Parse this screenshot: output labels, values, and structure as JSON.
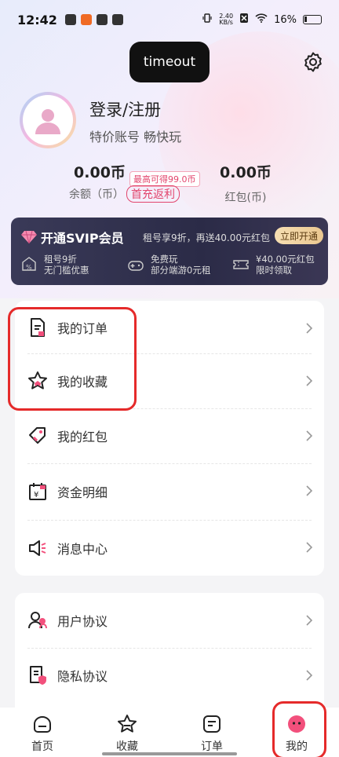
{
  "status_bar": {
    "time": "12:42",
    "net_speed_value": "2.40",
    "net_speed_unit": "KB/s",
    "battery": "16%"
  },
  "header": {
    "timeout_label": "timeout"
  },
  "profile": {
    "title": "登录/注册",
    "subtitle": "特价账号 畅快玩"
  },
  "balance": {
    "amount": "0.00币",
    "amount_label": "余额（币）",
    "recharge_tag": "首充返利",
    "max_tag": "最高可得99.0币",
    "red_packet": "0.00币",
    "red_packet_label": "红包(币)"
  },
  "vip": {
    "title": "开通SVIP会员",
    "desc": "租号享9折，再送40.00元红包",
    "button": "立即开通",
    "perks": [
      {
        "line1": "租号9折",
        "line2": "无门槛优惠"
      },
      {
        "line1": "免费玩",
        "line2": "部分端游0元租"
      },
      {
        "line1": "¥40.00元红包",
        "line2": "限时领取"
      }
    ]
  },
  "menu_group_1": [
    {
      "label": "我的订单",
      "icon": "document-icon"
    },
    {
      "label": "我的收藏",
      "icon": "star-icon"
    },
    {
      "label": "我的红包",
      "icon": "tag-icon"
    },
    {
      "label": "资金明细",
      "icon": "calendar-yen-icon"
    },
    {
      "label": "消息中心",
      "icon": "speaker-icon"
    }
  ],
  "menu_group_2": [
    {
      "label": "用户协议",
      "icon": "users-icon"
    },
    {
      "label": "隐私协议",
      "icon": "privacy-doc-icon"
    }
  ],
  "tabbar": [
    {
      "label": "首页",
      "icon": "home-icon"
    },
    {
      "label": "收藏",
      "icon": "favorite-icon"
    },
    {
      "label": "订单",
      "icon": "order-icon"
    },
    {
      "label": "我的",
      "icon": "me-icon",
      "active": true
    }
  ],
  "colors": {
    "accent": "#e2456d",
    "annotation": "#e52a2a",
    "vip_bg": "#2b2b47"
  }
}
